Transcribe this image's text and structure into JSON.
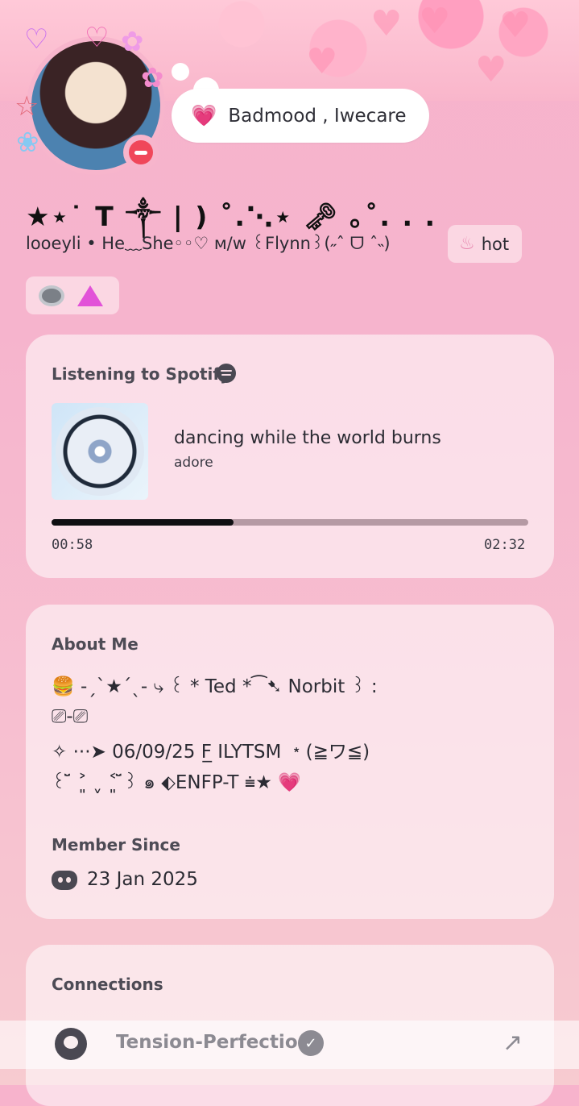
{
  "status": {
    "text": "Badmood , Iwecare"
  },
  "profile": {
    "display_name": "★⋆˙  T ༒ | )   ˚.⋱⋆ 🗝 ｡˚. . .",
    "username_line": "looeyli • He﹏She◦◦♡   ᴍ/ᴡ   ꒰Flynn꒱(˶ˆ ᗜ ˆ˵)",
    "tag": "hot"
  },
  "spotify": {
    "heading": "Listening to Spotify",
    "track": "dancing while the world burns",
    "artist": "adore",
    "elapsed": "00:58",
    "duration": "02:32",
    "progress": 0.3816
  },
  "about": {
    "heading": "About Me",
    "lines": [
      "🍔   -ˏˋ★ˊˎ-   ⤷   ꒰  * Ted   *⁀➷   Norbit   ꒱   :",
      "⎚-⎚",
      "      ✧   ···➤   06/09/25 F̲ ILYTSM ﹡(≧ワ≦)",
      "꒰ ̆̈ ˃͈ ˬ ˂͈ ̆̈꒱   ๑   ⬖ENFP-T   ⩧★   💗"
    ]
  },
  "member_since": {
    "heading": "Member Since",
    "date": "23 Jan 2025"
  },
  "connections": {
    "heading": "Connections",
    "items": [
      {
        "name": "Tension-Perfection"
      }
    ]
  },
  "colors": {
    "accent": "#f7b5cc",
    "card": "#fde3ea",
    "dnd": "#f0475a"
  },
  "icons": [
    "spotify-icon",
    "discord-icon",
    "github-icon",
    "verified-icon",
    "external-link-icon",
    "dnd-status-icon"
  ]
}
